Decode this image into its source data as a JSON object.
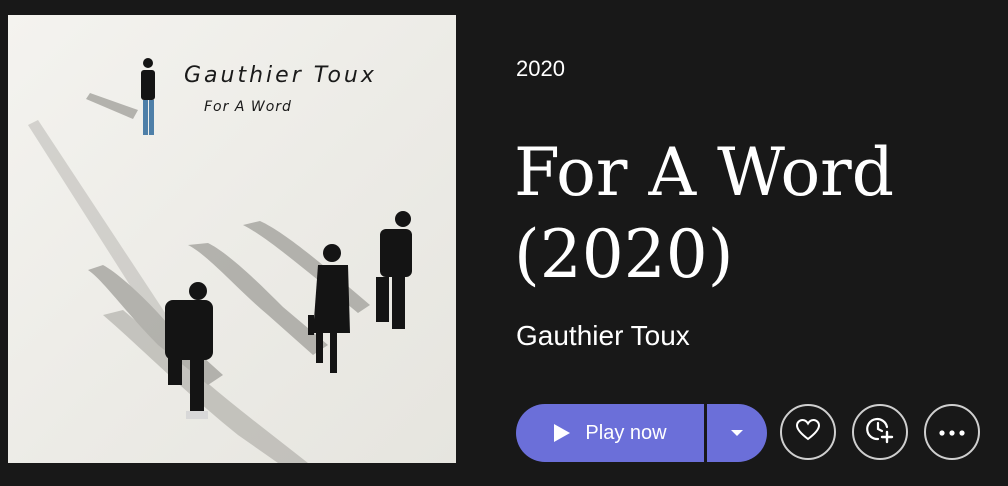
{
  "album": {
    "year": "2020",
    "title": "For A Word (2020)",
    "artist": "Gauthier Toux",
    "cover": {
      "artist_text": "Gauthier Toux",
      "title_text": "For A Word"
    }
  },
  "actions": {
    "play_label": "Play now",
    "play_icon": "play-icon",
    "dropdown_icon": "chevron-down-icon",
    "favorite_icon": "heart-icon",
    "listen_later_icon": "clock-plus-icon",
    "more_icon": "more-dots-icon"
  },
  "colors": {
    "background": "#181818",
    "accent": "#6b6fd9",
    "text": "#ffffff"
  }
}
